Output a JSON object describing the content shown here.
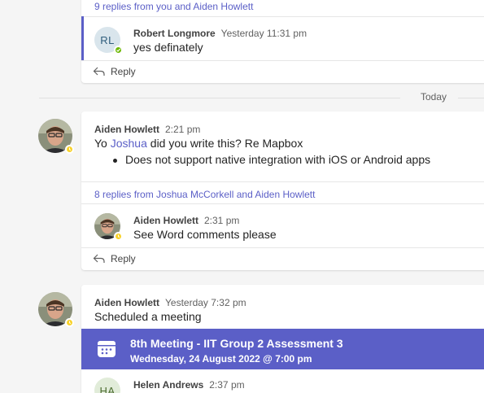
{
  "thread1": {
    "replies_summary": "9 replies from you and Aiden Howlett",
    "reply": {
      "author_initials": "RL",
      "author": "Robert Longmore",
      "time": "Yesterday 11:31 pm",
      "text": "yes definately"
    },
    "reply_label": "Reply"
  },
  "day_separator": "Today",
  "thread2": {
    "author": "Aiden Howlett",
    "time": "2:21 pm",
    "text_prefix": "Yo ",
    "mention": "Joshua",
    "text_suffix": " did you write this? Re Mapbox",
    "bullets": [
      "Does not support native integration with iOS or Android apps"
    ],
    "replies_summary": "8 replies from Joshua McCorkell and Aiden Howlett",
    "reply": {
      "author": "Aiden Howlett",
      "time": "2:31 pm",
      "text": "See Word comments please"
    },
    "reply_label": "Reply"
  },
  "thread3": {
    "author": "Aiden Howlett",
    "time": "Yesterday 7:32 pm",
    "text": "Scheduled a meeting",
    "meeting": {
      "title": "8th Meeting - IIT Group 2 Assessment 3",
      "datetime": "Wednesday, 24 August 2022 @ 7:00 pm"
    },
    "reply": {
      "author_initials": "HA",
      "author": "Helen Andrews",
      "time": "2:37 pm"
    }
  },
  "colors": {
    "accent": "#5b5fc7",
    "away": "#f8d22a",
    "available": "#6bb700"
  },
  "icons": [
    "reply-icon",
    "calendar-icon",
    "away-status-icon",
    "available-status-icon"
  ]
}
